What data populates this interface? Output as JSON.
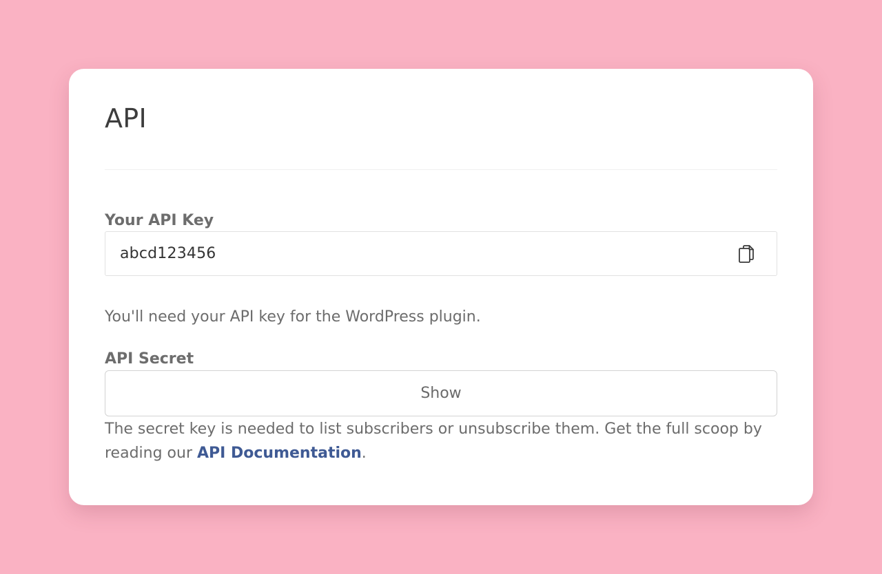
{
  "page": {
    "background_color": "#fab2c3",
    "card_color": "#ffffff"
  },
  "card": {
    "title": "API"
  },
  "api_key": {
    "label": "Your API Key",
    "value": "abcd123456",
    "copy_icon": "copy-icon",
    "help_text": "You'll need your API key for the WordPress plugin."
  },
  "api_secret": {
    "label": "API Secret",
    "show_button_label": "Show",
    "help_text_before": "The secret key is needed to list subscribers or unsubscribe them. Get the full scoop by reading our ",
    "docs_link_label": "API Documentation",
    "help_text_after": ".",
    "link_color": "#3f5a94"
  }
}
